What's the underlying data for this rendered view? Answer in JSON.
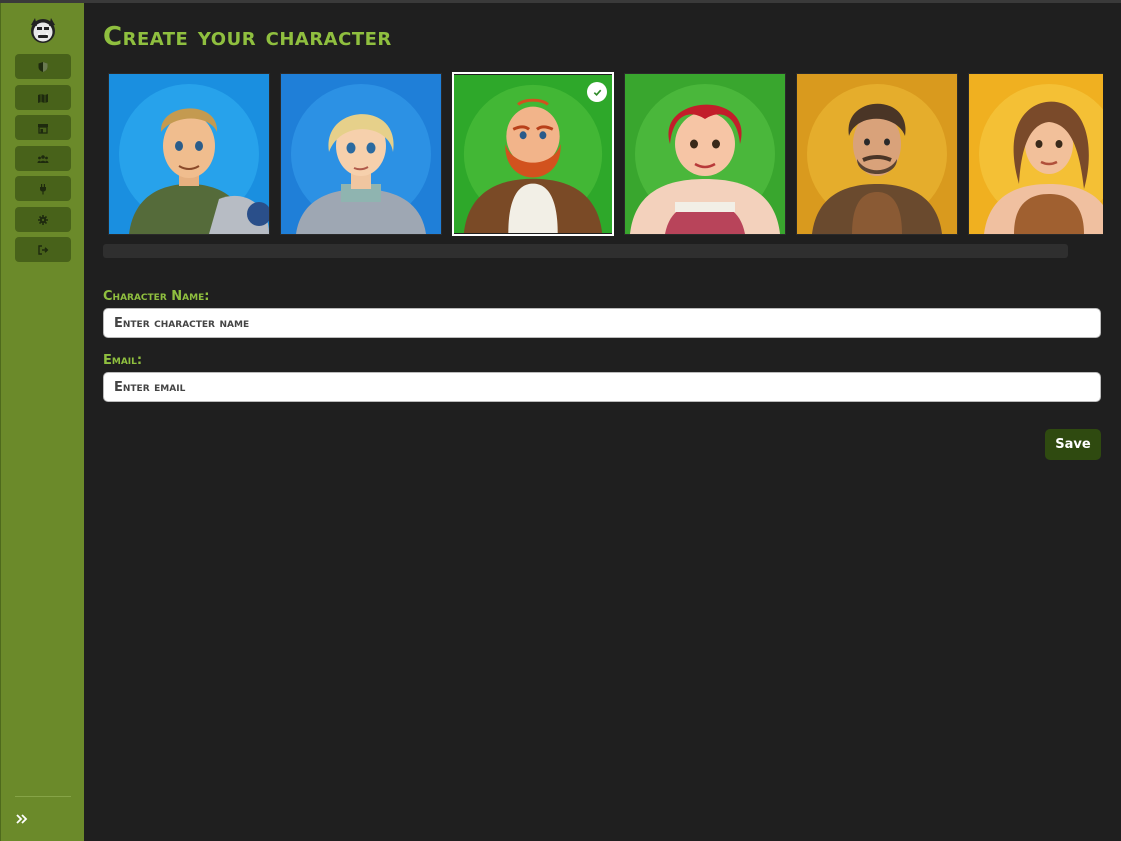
{
  "page": {
    "title": "Create your character"
  },
  "sidebar": {
    "logo_icon": "orc-mascot-icon",
    "items": [
      {
        "name": "shield",
        "icon": "shield-icon"
      },
      {
        "name": "map",
        "icon": "map-icon"
      },
      {
        "name": "store",
        "icon": "store-icon"
      },
      {
        "name": "users",
        "icon": "users-icon"
      },
      {
        "name": "plug",
        "icon": "plug-icon"
      },
      {
        "name": "settings",
        "icon": "gear-icon"
      },
      {
        "name": "logout",
        "icon": "logout-icon"
      }
    ],
    "expand_icon": "double-chevron-right-icon"
  },
  "characters": [
    {
      "name": "young-knight-man",
      "bg": "#1a8fe0",
      "selected": false
    },
    {
      "name": "young-knight-woman",
      "bg": "#1f7fd8",
      "selected": false
    },
    {
      "name": "bearded-dwarf-man",
      "bg": "#2ea82a",
      "selected": true
    },
    {
      "name": "red-haired-woman",
      "bg": "#39a62e",
      "selected": false
    },
    {
      "name": "rugged-craftsman-man",
      "bg": "#d99a1e",
      "selected": false
    },
    {
      "name": "apron-woman",
      "bg": "#f0b020",
      "selected": false
    }
  ],
  "form": {
    "name_label": "Character Name:",
    "name_placeholder": "Enter character name",
    "email_label": "Email:",
    "email_placeholder": "Enter email",
    "save_label": "Save"
  },
  "colors": {
    "sidebar": "#6b8a2a",
    "accent": "#8fbf3f",
    "background": "#1f1f1f",
    "save_button": "#2f4a10"
  }
}
